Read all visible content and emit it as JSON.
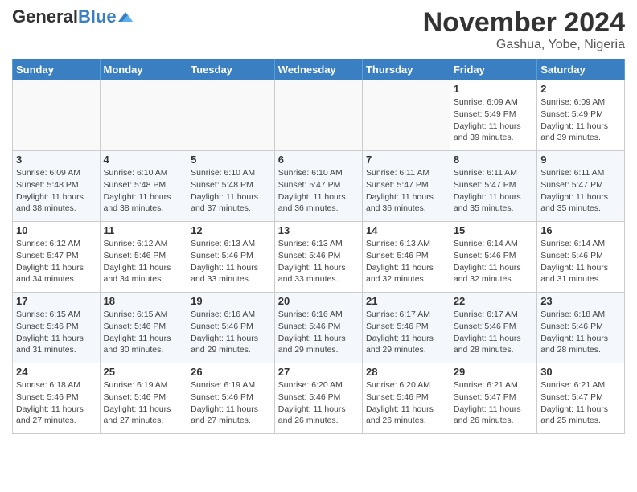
{
  "header": {
    "logo_general": "General",
    "logo_blue": "Blue",
    "title": "November 2024",
    "subtitle": "Gashua, Yobe, Nigeria"
  },
  "weekdays": [
    "Sunday",
    "Monday",
    "Tuesday",
    "Wednesday",
    "Thursday",
    "Friday",
    "Saturday"
  ],
  "weeks": [
    [
      {
        "day": "",
        "info": ""
      },
      {
        "day": "",
        "info": ""
      },
      {
        "day": "",
        "info": ""
      },
      {
        "day": "",
        "info": ""
      },
      {
        "day": "",
        "info": ""
      },
      {
        "day": "1",
        "info": "Sunrise: 6:09 AM\nSunset: 5:49 PM\nDaylight: 11 hours\nand 39 minutes."
      },
      {
        "day": "2",
        "info": "Sunrise: 6:09 AM\nSunset: 5:49 PM\nDaylight: 11 hours\nand 39 minutes."
      }
    ],
    [
      {
        "day": "3",
        "info": "Sunrise: 6:09 AM\nSunset: 5:48 PM\nDaylight: 11 hours\nand 38 minutes."
      },
      {
        "day": "4",
        "info": "Sunrise: 6:10 AM\nSunset: 5:48 PM\nDaylight: 11 hours\nand 38 minutes."
      },
      {
        "day": "5",
        "info": "Sunrise: 6:10 AM\nSunset: 5:48 PM\nDaylight: 11 hours\nand 37 minutes."
      },
      {
        "day": "6",
        "info": "Sunrise: 6:10 AM\nSunset: 5:47 PM\nDaylight: 11 hours\nand 36 minutes."
      },
      {
        "day": "7",
        "info": "Sunrise: 6:11 AM\nSunset: 5:47 PM\nDaylight: 11 hours\nand 36 minutes."
      },
      {
        "day": "8",
        "info": "Sunrise: 6:11 AM\nSunset: 5:47 PM\nDaylight: 11 hours\nand 35 minutes."
      },
      {
        "day": "9",
        "info": "Sunrise: 6:11 AM\nSunset: 5:47 PM\nDaylight: 11 hours\nand 35 minutes."
      }
    ],
    [
      {
        "day": "10",
        "info": "Sunrise: 6:12 AM\nSunset: 5:47 PM\nDaylight: 11 hours\nand 34 minutes."
      },
      {
        "day": "11",
        "info": "Sunrise: 6:12 AM\nSunset: 5:46 PM\nDaylight: 11 hours\nand 34 minutes."
      },
      {
        "day": "12",
        "info": "Sunrise: 6:13 AM\nSunset: 5:46 PM\nDaylight: 11 hours\nand 33 minutes."
      },
      {
        "day": "13",
        "info": "Sunrise: 6:13 AM\nSunset: 5:46 PM\nDaylight: 11 hours\nand 33 minutes."
      },
      {
        "day": "14",
        "info": "Sunrise: 6:13 AM\nSunset: 5:46 PM\nDaylight: 11 hours\nand 32 minutes."
      },
      {
        "day": "15",
        "info": "Sunrise: 6:14 AM\nSunset: 5:46 PM\nDaylight: 11 hours\nand 32 minutes."
      },
      {
        "day": "16",
        "info": "Sunrise: 6:14 AM\nSunset: 5:46 PM\nDaylight: 11 hours\nand 31 minutes."
      }
    ],
    [
      {
        "day": "17",
        "info": "Sunrise: 6:15 AM\nSunset: 5:46 PM\nDaylight: 11 hours\nand 31 minutes."
      },
      {
        "day": "18",
        "info": "Sunrise: 6:15 AM\nSunset: 5:46 PM\nDaylight: 11 hours\nand 30 minutes."
      },
      {
        "day": "19",
        "info": "Sunrise: 6:16 AM\nSunset: 5:46 PM\nDaylight: 11 hours\nand 29 minutes."
      },
      {
        "day": "20",
        "info": "Sunrise: 6:16 AM\nSunset: 5:46 PM\nDaylight: 11 hours\nand 29 minutes."
      },
      {
        "day": "21",
        "info": "Sunrise: 6:17 AM\nSunset: 5:46 PM\nDaylight: 11 hours\nand 29 minutes."
      },
      {
        "day": "22",
        "info": "Sunrise: 6:17 AM\nSunset: 5:46 PM\nDaylight: 11 hours\nand 28 minutes."
      },
      {
        "day": "23",
        "info": "Sunrise: 6:18 AM\nSunset: 5:46 PM\nDaylight: 11 hours\nand 28 minutes."
      }
    ],
    [
      {
        "day": "24",
        "info": "Sunrise: 6:18 AM\nSunset: 5:46 PM\nDaylight: 11 hours\nand 27 minutes."
      },
      {
        "day": "25",
        "info": "Sunrise: 6:19 AM\nSunset: 5:46 PM\nDaylight: 11 hours\nand 27 minutes."
      },
      {
        "day": "26",
        "info": "Sunrise: 6:19 AM\nSunset: 5:46 PM\nDaylight: 11 hours\nand 27 minutes."
      },
      {
        "day": "27",
        "info": "Sunrise: 6:20 AM\nSunset: 5:46 PM\nDaylight: 11 hours\nand 26 minutes."
      },
      {
        "day": "28",
        "info": "Sunrise: 6:20 AM\nSunset: 5:46 PM\nDaylight: 11 hours\nand 26 minutes."
      },
      {
        "day": "29",
        "info": "Sunrise: 6:21 AM\nSunset: 5:47 PM\nDaylight: 11 hours\nand 26 minutes."
      },
      {
        "day": "30",
        "info": "Sunrise: 6:21 AM\nSunset: 5:47 PM\nDaylight: 11 hours\nand 25 minutes."
      }
    ]
  ]
}
